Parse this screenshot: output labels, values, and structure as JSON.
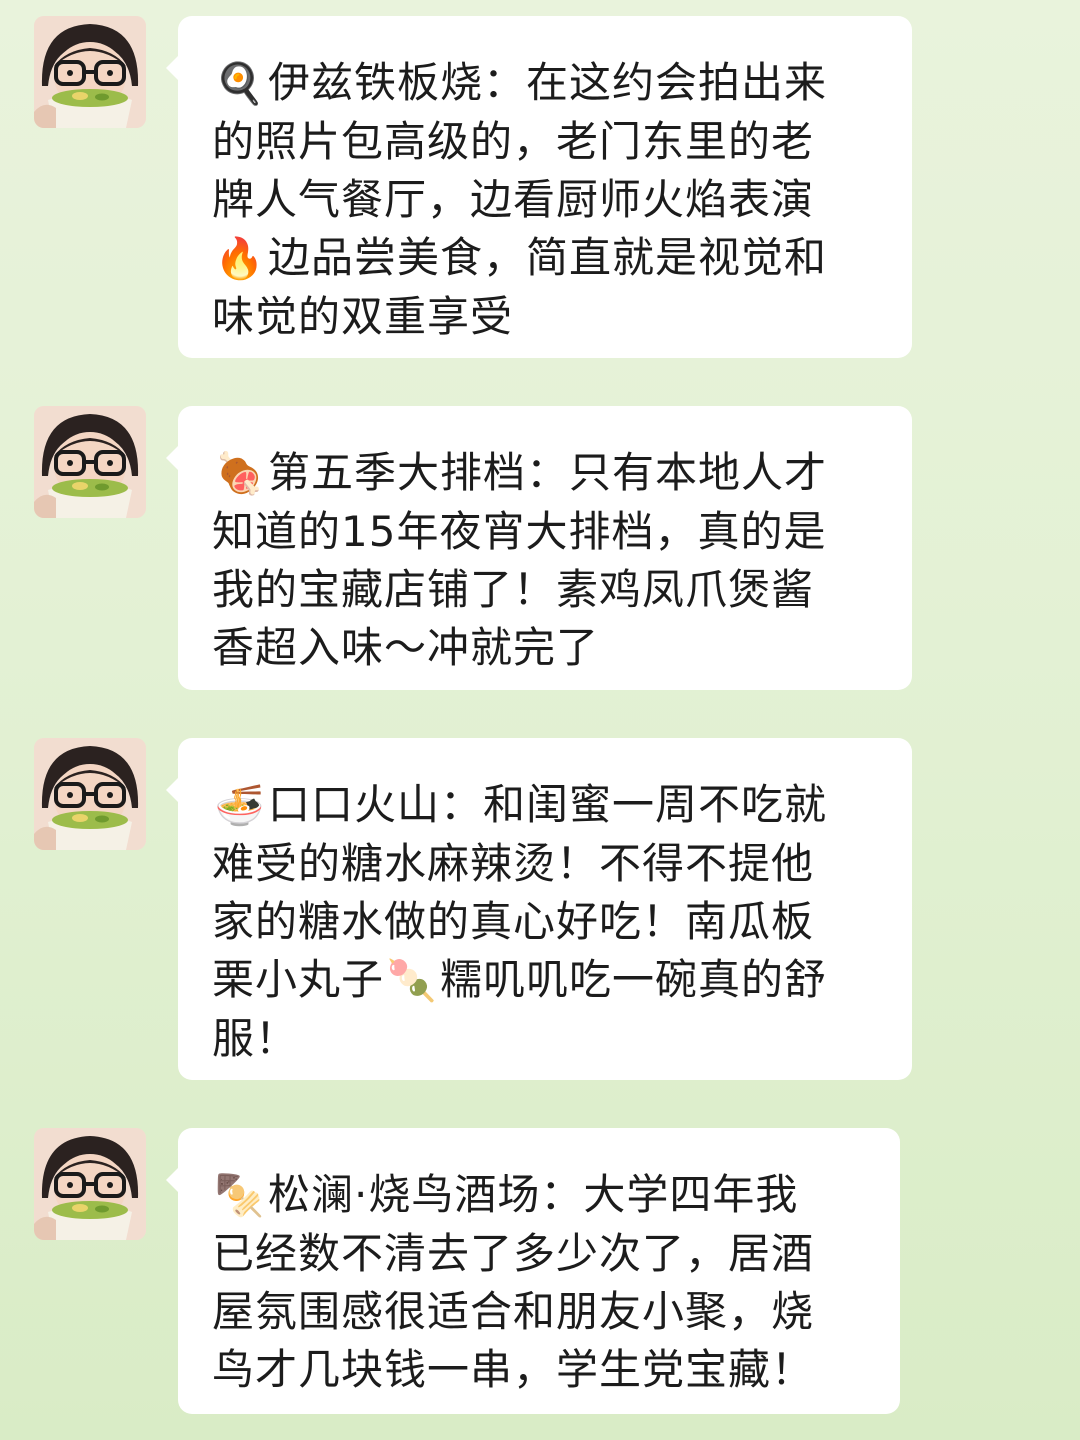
{
  "messages": [
    {
      "lines": [
        {
          "emoji": "🍳",
          "text": "伊兹铁板烧：在这约会拍出来"
        },
        {
          "text": "的照片包高级的，老门东里的老"
        },
        {
          "text": "牌人气餐厅，边看厨师火焰表演"
        },
        {
          "emoji": "🔥",
          "text": "边品尝美食，简直就是视觉和"
        },
        {
          "text": "味觉的双重享受"
        }
      ]
    },
    {
      "lines": [
        {
          "emoji": "🍖",
          "text": "第五季大排档：只有本地人才"
        },
        {
          "text": "知道的15年夜宵大排档，真的是"
        },
        {
          "text": "我的宝藏店铺了！素鸡凤爪煲酱"
        },
        {
          "text": "香超入味～冲就完了"
        }
      ]
    },
    {
      "lines": [
        {
          "emoji": "🍜",
          "text": "口口火山：和闺蜜一周不吃就"
        },
        {
          "text": "难受的糖水麻辣烫！不得不提他"
        },
        {
          "text": "家的糖水做的真心好吃！南瓜板"
        },
        {
          "text": "栗小丸子",
          "emoji_after": "🍡",
          "text_after": "糯叽叽吃一碗真的舒"
        },
        {
          "text": "服！"
        }
      ]
    },
    {
      "lines": [
        {
          "emoji": "🍢",
          "text": "松澜·烧鸟酒场：大学四年我"
        },
        {
          "text": "已经数不清去了多少次了，居酒"
        },
        {
          "text": "屋氛围感很适合和朋友小聚，烧"
        },
        {
          "text": "鸟才几块钱一串，学生党宝藏！"
        }
      ]
    }
  ],
  "avatar_icon": "girl-with-glasses-eating-bowl"
}
